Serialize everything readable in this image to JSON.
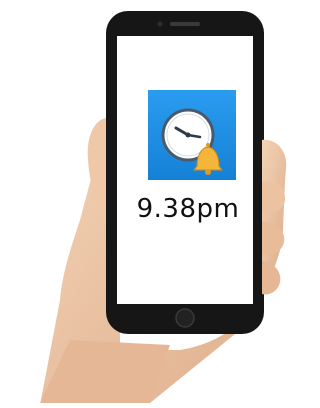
{
  "screen": {
    "time_text": "9.38pm"
  },
  "app_icon": {
    "name": "alarm-clock-app-icon",
    "background_color": "#1e90e6",
    "bell_color": "#f4b63a"
  },
  "colors": {
    "phone_body": "#161616",
    "screen": "#ffffff",
    "skin": "#efc8a8"
  }
}
